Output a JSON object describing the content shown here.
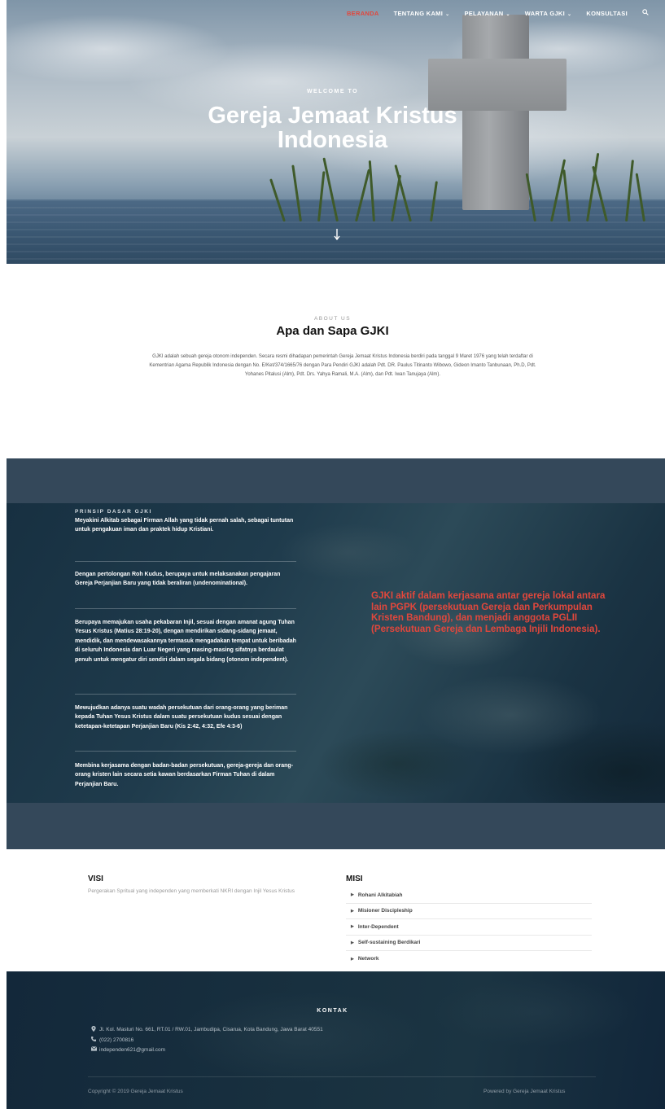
{
  "nav": {
    "items": [
      {
        "label": "BERANDA",
        "active": true,
        "dropdown": false
      },
      {
        "label": "TENTANG KAMI",
        "active": false,
        "dropdown": true
      },
      {
        "label": "PELAYANAN",
        "active": false,
        "dropdown": true
      },
      {
        "label": "WARTA GJKI",
        "active": false,
        "dropdown": true
      },
      {
        "label": "KONSULTASI",
        "active": false,
        "dropdown": false
      }
    ],
    "search_icon": "search-icon"
  },
  "hero": {
    "kicker": "WELCOME TO",
    "title_line1": "Gereja Jemaat Kristus",
    "title_line2": "Indonesia",
    "arrow_icon": "arrow-down-icon"
  },
  "about": {
    "kicker": "ABOUT US",
    "title": "Apa dan Sapa GJKI",
    "body": "GJKI adalah sebuah gereja otonom independen. Secara resmi dihadapan pemerintah Gereja Jemaat Kristus Indonesia berdiri pada tanggal 9 Maret 1976 yang telah terdaftar di Kementrian Agama Republik Indonesia dengan No. E/Ket/374/1665/76 dengan Para Pendiri GJKI adalah Pdt. DR. Paulus Titinanto Wibowo, Gideon Imanto Tanbunaan, Ph.D, Pdt. Yohanes Pitalusi (Alm), Pdt. Drs. Yahya Ramali, M.A. (Alm), dan Pdt. Iwan Tanujaya (Alm)."
  },
  "prinsip": {
    "kicker": "PRINSIP DASAR GJKI",
    "items": [
      "Meyakini Alkitab sebagai Firman Allah yang tidak pernah salah, sebagai tuntutan untuk pengakuan iman dan praktek hidup Kristiani.",
      "Dengan pertolongan Roh Kudus, berupaya untuk melaksanakan pengajaran Gereja Perjanjian Baru yang tidak beraliran (undenominational).",
      "Berupaya memajukan usaha pekabaran Injil, sesuai dengan amanat agung Tuhan Yesus Kristus (Matius 28:19-20), dengan mendirikan sidang-sidang jemaat, mendidik, dan mendewasakannya termasuk mengadakan tempat untuk beribadah di seluruh Indonesia dan Luar Negeri yang masing-masing sifatnya berdaulat penuh untuk mengatur diri sendiri dalam segala bidang (otonom independent).",
      "Mewujudkan adanya suatu wadah persekutuan dari orang-orang yang beriman kepada Tuhan Yesus Kristus dalam suatu persekutuan kudus sesuai dengan ketetapan-ketetapan Perjanjian Baru (Kis 2:42, 4:32, Efe 4:3-6)",
      "Membina kerjasama dengan badan-badan persekutuan, gereja-gereja dan orang-orang kristen lain secara setia kawan berdasarkan Firman Tuhan di dalam Perjanjian Baru."
    ],
    "quote": "GJKI aktif dalam kerjasama antar gereja lokal antara lain PGPK (persekutuan Gereja dan Perkumpulan Kristen Bandung), dan menjadi anggota PGLII (Persekutuan Gereja dan Lembaga Injili Indonesia).",
    "quote_color": "#e2473c"
  },
  "visi": {
    "title": "VISI",
    "text": "Pergerakan Spritual yang independen yang memberkati NKRI dengan Injil Yesus Kristus"
  },
  "misi": {
    "title": "MISI",
    "items": [
      "Rohani Alkitabiah",
      "Misioner Discipleship",
      "Inter-Dependent",
      "Self-sustaining Berdikari",
      "Network"
    ]
  },
  "footer": {
    "kontak_title": "KONTAK",
    "address": "Jl. Kol. Masturi No. 661, RT.01 / RW.01, Jambudipa, Cisarua, Kota Bandung, Jawa Barat 40551",
    "phone": "(022) 2700816",
    "email": "independen621@gmail.com",
    "copyright": "Copyright © 2019 Gereja Jemaat Kristus",
    "powered": "Powered by Gereja Jemaat Kristus"
  },
  "colors": {
    "accent": "#e2473c",
    "band": "#34485a",
    "footer_bg": "#18303f"
  }
}
